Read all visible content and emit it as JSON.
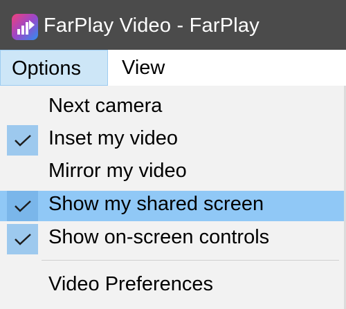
{
  "window": {
    "title": "FarPlay Video - FarPlay",
    "icon": "farplay-app-icon"
  },
  "menubar": {
    "items": [
      {
        "label": "Options",
        "active": true
      },
      {
        "label": "View",
        "active": false
      }
    ]
  },
  "dropdown": {
    "items": [
      {
        "label": "Next camera",
        "checked": false,
        "highlighted": false
      },
      {
        "label": "Inset my video",
        "checked": true,
        "highlighted": false
      },
      {
        "label": "Mirror my video",
        "checked": false,
        "highlighted": false
      },
      {
        "label": "Show my shared screen",
        "checked": true,
        "highlighted": true
      },
      {
        "label": "Show on-screen controls",
        "checked": true,
        "highlighted": false
      },
      {
        "label": "Video Preferences",
        "checked": false,
        "highlighted": false
      }
    ],
    "check_icon": "checkmark-icon"
  },
  "colors": {
    "titlebar": "#4b4b4b",
    "menu_active": "#cde6f7",
    "highlight": "#90c8f6",
    "check_bg": "#9dc9ee"
  }
}
